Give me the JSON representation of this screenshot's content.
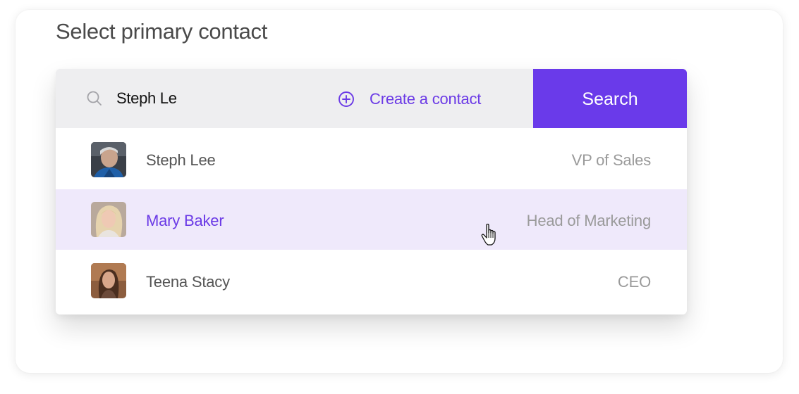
{
  "heading": "Select primary contact",
  "search": {
    "value": "Steph Le",
    "icon": "search-icon",
    "create_label": "Create a contact",
    "create_icon": "plus-circle-icon",
    "button_label": "Search"
  },
  "contacts": [
    {
      "name": "Steph Lee",
      "role": "VP of Sales",
      "highlighted": false
    },
    {
      "name": "Mary Baker",
      "role": "Head of Marketing",
      "highlighted": true
    },
    {
      "name": "Teena Stacy",
      "role": "CEO",
      "highlighted": false
    }
  ],
  "colors": {
    "accent": "#6a3aea",
    "search_bar_bg": "#eeeef0",
    "highlight_bg": "#efe9fb",
    "name_text": "#555555",
    "role_text": "#9a9a9a"
  }
}
